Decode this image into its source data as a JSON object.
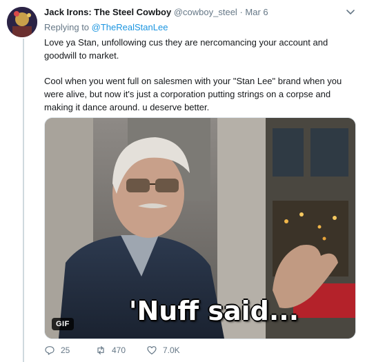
{
  "tweet": {
    "author_name": "Jack Irons: The Steel Cowboy",
    "author_handle": "@cowboy_steel",
    "separator": "·",
    "date": "Mar 6",
    "replying_prefix": "Replying to",
    "replying_to": "@TheRealStanLee",
    "paragraphs": [
      "Love ya Stan, unfollowing cus they are nercomancing your account and goodwill to market.",
      "Cool when you went full on salesmen with your \"Stan Lee\" brand when you were alive, but now it's just a corporation putting strings on a corpse and making it dance around. u deserve better."
    ],
    "media": {
      "badge": "GIF",
      "caption": "'Nuff said..."
    },
    "stats": {
      "replies": "25",
      "retweets": "470",
      "likes": "7.0K"
    }
  },
  "colors": {
    "link": "#1b95e0",
    "muted": "#657786",
    "text": "#14171a"
  },
  "icons": [
    "avatar",
    "chevron-down-icon",
    "reply-icon",
    "retweet-icon",
    "heart-icon"
  ]
}
